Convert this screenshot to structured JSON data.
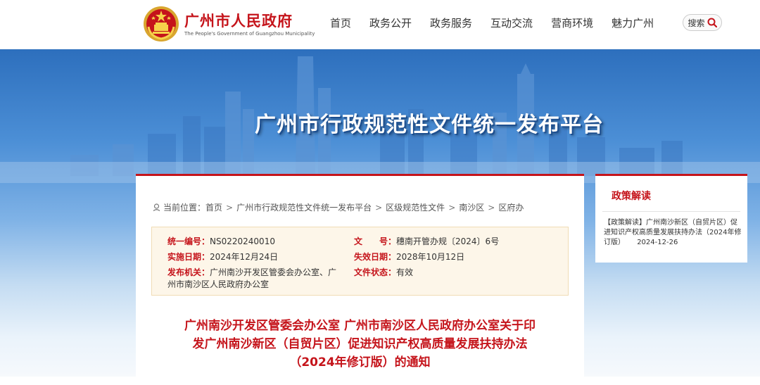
{
  "header": {
    "site_title": "广州市人民政府",
    "site_subtitle": "The People's Government of Guangzhou Municipality",
    "logo_icon": "national-emblem-icon",
    "nav": [
      "首页",
      "政务公开",
      "政务服务",
      "互动交流",
      "营商环境",
      "魅力广州"
    ],
    "search_label": "搜索",
    "search_icon": "magnifier-icon"
  },
  "banner": {
    "title": "广州市行政规范性文件统一发布平台"
  },
  "breadcrumb": {
    "prefix": "当前位置：",
    "items": [
      "首页",
      "广州市行政规范性文件统一发布平台",
      "区级规范性文件",
      "南沙区",
      "区府办"
    ],
    "separator": ">"
  },
  "doc_info": {
    "serial_label": "统一编号：",
    "serial_value": "NS0220240010",
    "number_label": "文　　号：",
    "number_value": "穗南开管办规〔2024〕6号",
    "effective_label": "实施日期：",
    "effective_value": "2024年12月24日",
    "expiry_label": "失效日期：",
    "expiry_value": "2028年10月12日",
    "issuer_label": "发布机关：",
    "issuer_value": "广州南沙开发区管委会办公室、广州市南沙区人民政府办公室",
    "status_label": "文件状态：",
    "status_value": "有效"
  },
  "doc_title": {
    "line1": "广州南沙开发区管委会办公室 广州市南沙区人民政府办公室关于印",
    "line2": "发广州南沙新区（自贸片区）促进知识产权高质量发展扶持办法",
    "line3": "（2024年修订版）的通知"
  },
  "side": {
    "title": "政策解读",
    "item_text": "【政策解读】广州南沙新区（自贸片区）促进知识产权高质量发展扶持办法（2024年修订版）",
    "item_date": "2024-12-26"
  },
  "colors": {
    "brand_red": "#c5141b",
    "info_bg": "#fdf6e9",
    "banner_blue": "#2d6fbd"
  }
}
